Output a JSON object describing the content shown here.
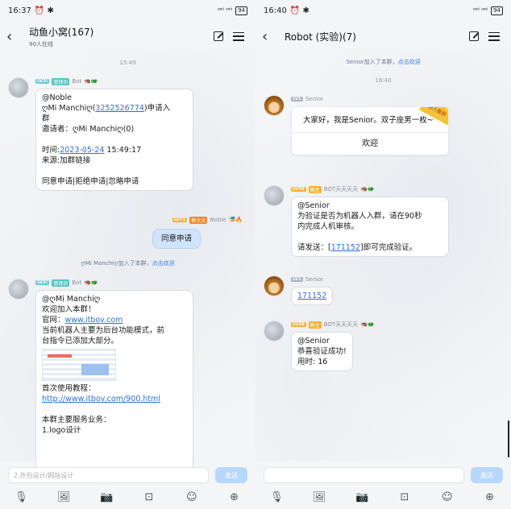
{
  "left": {
    "status": {
      "time": "16:37",
      "icons": "⏰ ✱",
      "signal": "⁹⁶ᴵˡ ⁹⁶ᴵˡ",
      "battery": "94"
    },
    "header": {
      "title": "动鱼小窝(167)",
      "subtitle": "90人在线"
    },
    "time1": "15:49",
    "msg1": {
      "level": "LV3!",
      "role": "管理员",
      "name": "Bot",
      "emoji": "🦔🐲",
      "lines": {
        "l1": "@Noble",
        "l2_pre": "ღMi Manchiღ(",
        "l2_link": "3252526774",
        "l2_post": ")申请入",
        "l3": "群",
        "l4": "邀请者：ღMi Manchiღ(0)",
        "l5_pre": "时间:",
        "l5_link": "2023-05-24",
        "l5_post": " 15:49:17",
        "l6": "来源:加群链接",
        "l7": "同意申请|拒绝申请|忽略申请"
      }
    },
    "msg2": {
      "level": "LV72",
      "role": "群大大",
      "name": "Noble",
      "emoji": "🎏🔥",
      "text": "同意申请"
    },
    "sys1": {
      "who": "ღMi Manchiღ加入了本群，",
      "link": "点击欢迎"
    },
    "msg3": {
      "level": "LV3!",
      "role": "管理员",
      "name": "Bot",
      "emoji": "🦔🐲",
      "lines": {
        "l1": "@ღMi Manchiღ",
        "l2": "欢迎加入本群！",
        "l3_pre": "官网：",
        "l3_link": "www.itbov.com",
        "l4": "当前机器人主要为后台功能模式，前",
        "l5": "台指令已添加大部分。",
        "l6": "首次使用教程：",
        "l7_link": "http://www.itbov.com/900.html",
        "l8": "本群主要服务业务：",
        "l9": "1.logo设计"
      }
    },
    "input": {
      "placeholder": "2.外包设计/网站设计",
      "send": "发送"
    }
  },
  "right": {
    "status": {
      "time": "16:40",
      "icons": "⏰ ✱",
      "signal": "⁹⁶ᴵˡ ⁹⁶ᴵˡ",
      "battery": "94"
    },
    "header": {
      "title": "Robot (实验)(7)"
    },
    "sys1": {
      "who": "Senior加入了本群，",
      "link": "点击欢迎"
    },
    "time1": "16:40",
    "msg1": {
      "level": "LV1",
      "name": "Senior",
      "card_text": "大家好，我是Senior。双子座男一枚~",
      "card_btn": "欢迎",
      "ribbon": "新人报到"
    },
    "msg2": {
      "level": "LV30",
      "role": "群主",
      "name": "BOT天天天天",
      "emoji": "🦔🐲",
      "lines": {
        "l1": "@Senior",
        "l2": "为验证是否为机器人入群，请在90秒",
        "l3": "内完成人机审核。",
        "l4_pre": "请发送：[",
        "l4_link": "171152",
        "l4_post": "]即可完成验证。"
      }
    },
    "msg3": {
      "level": "LV1",
      "name": "Senior",
      "text": "171152"
    },
    "msg4": {
      "level": "LV30",
      "role": "群主",
      "name": "BOT天天天天",
      "emoji": "🦔🐲",
      "lines": {
        "l1": "@Senior",
        "l2": "恭喜验证成功!",
        "l3": "用时: 16"
      }
    },
    "input": {
      "send": "发送"
    }
  },
  "icons": [
    "back-icon",
    "edit-icon",
    "menu-icon",
    "mic-icon",
    "image-icon",
    "camera-icon",
    "gift-icon",
    "emoji-icon",
    "plus-icon"
  ]
}
